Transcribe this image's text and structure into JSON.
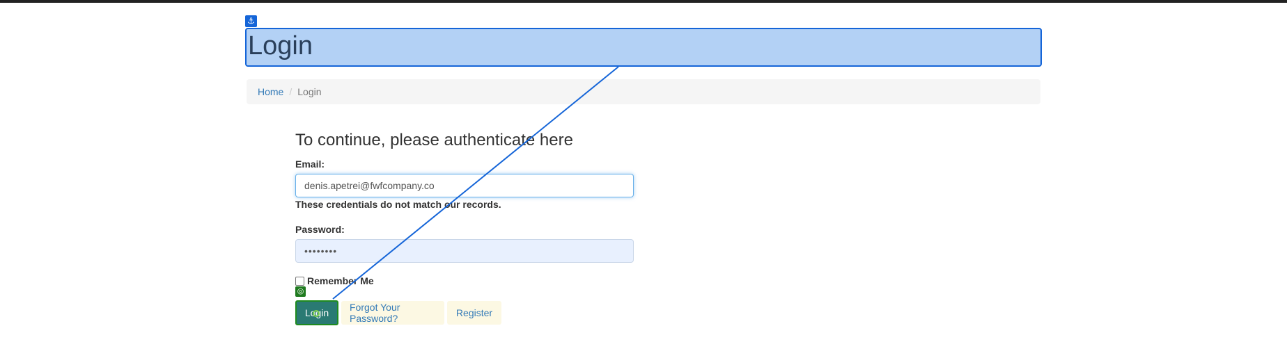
{
  "page": {
    "title": "Login"
  },
  "breadcrumb": {
    "home": "Home",
    "separator": "/",
    "current": "Login"
  },
  "form": {
    "heading": "To continue, please authenticate here",
    "email_label": "Email:",
    "email_value": "denis.apetrei@fwfcompany.co",
    "error_message": "These credentials do not match our records.",
    "password_label": "Password:",
    "password_value": "••••••••",
    "remember_label": "Remember Me",
    "remember_checked": false
  },
  "actions": {
    "login_label": "Login",
    "forgot_label": "Forgot Your Password?",
    "register_label": "Register"
  },
  "overlay": {
    "anchor_icon": "anchor-icon",
    "target_icon": "target-icon",
    "anchor_color": "#1565d8",
    "target_color": "#1f7a1f"
  }
}
